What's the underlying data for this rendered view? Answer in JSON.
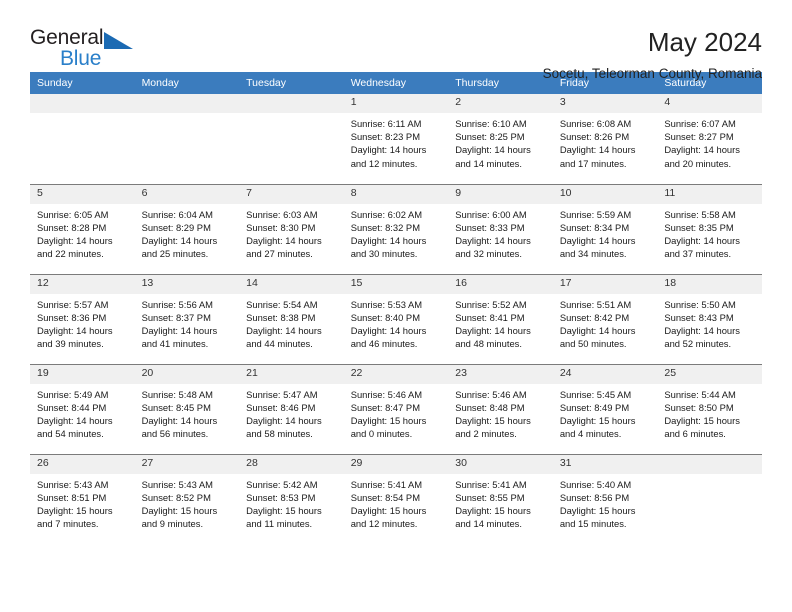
{
  "logo": {
    "word_one": "General",
    "word_two": "Blue",
    "triangle_icon": "blue-triangle-icon",
    "accent_dark": "#231f20",
    "accent_blue": "#2a7fc9"
  },
  "header": {
    "month_title": "May 2024",
    "location": "Socetu, Teleorman County, Romania",
    "header_bg": "#3b7cbe",
    "daynum_bg": "#f0f0f0"
  },
  "calendar": {
    "weekday_headers": [
      "Sunday",
      "Monday",
      "Tuesday",
      "Wednesday",
      "Thursday",
      "Friday",
      "Saturday"
    ],
    "weeks": [
      [
        {
          "day": "",
          "blank": true,
          "lines": []
        },
        {
          "day": "",
          "blank": true,
          "lines": []
        },
        {
          "day": "",
          "blank": true,
          "lines": []
        },
        {
          "day": "1",
          "blank": false,
          "lines": [
            "Sunrise: 6:11 AM",
            "Sunset: 8:23 PM",
            "Daylight: 14 hours",
            "and 12 minutes."
          ]
        },
        {
          "day": "2",
          "blank": false,
          "lines": [
            "Sunrise: 6:10 AM",
            "Sunset: 8:25 PM",
            "Daylight: 14 hours",
            "and 14 minutes."
          ]
        },
        {
          "day": "3",
          "blank": false,
          "lines": [
            "Sunrise: 6:08 AM",
            "Sunset: 8:26 PM",
            "Daylight: 14 hours",
            "and 17 minutes."
          ]
        },
        {
          "day": "4",
          "blank": false,
          "lines": [
            "Sunrise: 6:07 AM",
            "Sunset: 8:27 PM",
            "Daylight: 14 hours",
            "and 20 minutes."
          ]
        }
      ],
      [
        {
          "day": "5",
          "blank": false,
          "lines": [
            "Sunrise: 6:05 AM",
            "Sunset: 8:28 PM",
            "Daylight: 14 hours",
            "and 22 minutes."
          ]
        },
        {
          "day": "6",
          "blank": false,
          "lines": [
            "Sunrise: 6:04 AM",
            "Sunset: 8:29 PM",
            "Daylight: 14 hours",
            "and 25 minutes."
          ]
        },
        {
          "day": "7",
          "blank": false,
          "lines": [
            "Sunrise: 6:03 AM",
            "Sunset: 8:30 PM",
            "Daylight: 14 hours",
            "and 27 minutes."
          ]
        },
        {
          "day": "8",
          "blank": false,
          "lines": [
            "Sunrise: 6:02 AM",
            "Sunset: 8:32 PM",
            "Daylight: 14 hours",
            "and 30 minutes."
          ]
        },
        {
          "day": "9",
          "blank": false,
          "lines": [
            "Sunrise: 6:00 AM",
            "Sunset: 8:33 PM",
            "Daylight: 14 hours",
            "and 32 minutes."
          ]
        },
        {
          "day": "10",
          "blank": false,
          "lines": [
            "Sunrise: 5:59 AM",
            "Sunset: 8:34 PM",
            "Daylight: 14 hours",
            "and 34 minutes."
          ]
        },
        {
          "day": "11",
          "blank": false,
          "lines": [
            "Sunrise: 5:58 AM",
            "Sunset: 8:35 PM",
            "Daylight: 14 hours",
            "and 37 minutes."
          ]
        }
      ],
      [
        {
          "day": "12",
          "blank": false,
          "lines": [
            "Sunrise: 5:57 AM",
            "Sunset: 8:36 PM",
            "Daylight: 14 hours",
            "and 39 minutes."
          ]
        },
        {
          "day": "13",
          "blank": false,
          "lines": [
            "Sunrise: 5:56 AM",
            "Sunset: 8:37 PM",
            "Daylight: 14 hours",
            "and 41 minutes."
          ]
        },
        {
          "day": "14",
          "blank": false,
          "lines": [
            "Sunrise: 5:54 AM",
            "Sunset: 8:38 PM",
            "Daylight: 14 hours",
            "and 44 minutes."
          ]
        },
        {
          "day": "15",
          "blank": false,
          "lines": [
            "Sunrise: 5:53 AM",
            "Sunset: 8:40 PM",
            "Daylight: 14 hours",
            "and 46 minutes."
          ]
        },
        {
          "day": "16",
          "blank": false,
          "lines": [
            "Sunrise: 5:52 AM",
            "Sunset: 8:41 PM",
            "Daylight: 14 hours",
            "and 48 minutes."
          ]
        },
        {
          "day": "17",
          "blank": false,
          "lines": [
            "Sunrise: 5:51 AM",
            "Sunset: 8:42 PM",
            "Daylight: 14 hours",
            "and 50 minutes."
          ]
        },
        {
          "day": "18",
          "blank": false,
          "lines": [
            "Sunrise: 5:50 AM",
            "Sunset: 8:43 PM",
            "Daylight: 14 hours",
            "and 52 minutes."
          ]
        }
      ],
      [
        {
          "day": "19",
          "blank": false,
          "lines": [
            "Sunrise: 5:49 AM",
            "Sunset: 8:44 PM",
            "Daylight: 14 hours",
            "and 54 minutes."
          ]
        },
        {
          "day": "20",
          "blank": false,
          "lines": [
            "Sunrise: 5:48 AM",
            "Sunset: 8:45 PM",
            "Daylight: 14 hours",
            "and 56 minutes."
          ]
        },
        {
          "day": "21",
          "blank": false,
          "lines": [
            "Sunrise: 5:47 AM",
            "Sunset: 8:46 PM",
            "Daylight: 14 hours",
            "and 58 minutes."
          ]
        },
        {
          "day": "22",
          "blank": false,
          "lines": [
            "Sunrise: 5:46 AM",
            "Sunset: 8:47 PM",
            "Daylight: 15 hours",
            "and 0 minutes."
          ]
        },
        {
          "day": "23",
          "blank": false,
          "lines": [
            "Sunrise: 5:46 AM",
            "Sunset: 8:48 PM",
            "Daylight: 15 hours",
            "and 2 minutes."
          ]
        },
        {
          "day": "24",
          "blank": false,
          "lines": [
            "Sunrise: 5:45 AM",
            "Sunset: 8:49 PM",
            "Daylight: 15 hours",
            "and 4 minutes."
          ]
        },
        {
          "day": "25",
          "blank": false,
          "lines": [
            "Sunrise: 5:44 AM",
            "Sunset: 8:50 PM",
            "Daylight: 15 hours",
            "and 6 minutes."
          ]
        }
      ],
      [
        {
          "day": "26",
          "blank": false,
          "lines": [
            "Sunrise: 5:43 AM",
            "Sunset: 8:51 PM",
            "Daylight: 15 hours",
            "and 7 minutes."
          ]
        },
        {
          "day": "27",
          "blank": false,
          "lines": [
            "Sunrise: 5:43 AM",
            "Sunset: 8:52 PM",
            "Daylight: 15 hours",
            "and 9 minutes."
          ]
        },
        {
          "day": "28",
          "blank": false,
          "lines": [
            "Sunrise: 5:42 AM",
            "Sunset: 8:53 PM",
            "Daylight: 15 hours",
            "and 11 minutes."
          ]
        },
        {
          "day": "29",
          "blank": false,
          "lines": [
            "Sunrise: 5:41 AM",
            "Sunset: 8:54 PM",
            "Daylight: 15 hours",
            "and 12 minutes."
          ]
        },
        {
          "day": "30",
          "blank": false,
          "lines": [
            "Sunrise: 5:41 AM",
            "Sunset: 8:55 PM",
            "Daylight: 15 hours",
            "and 14 minutes."
          ]
        },
        {
          "day": "31",
          "blank": false,
          "lines": [
            "Sunrise: 5:40 AM",
            "Sunset: 8:56 PM",
            "Daylight: 15 hours",
            "and 15 minutes."
          ]
        },
        {
          "day": "",
          "blank": true,
          "lines": []
        }
      ]
    ]
  }
}
